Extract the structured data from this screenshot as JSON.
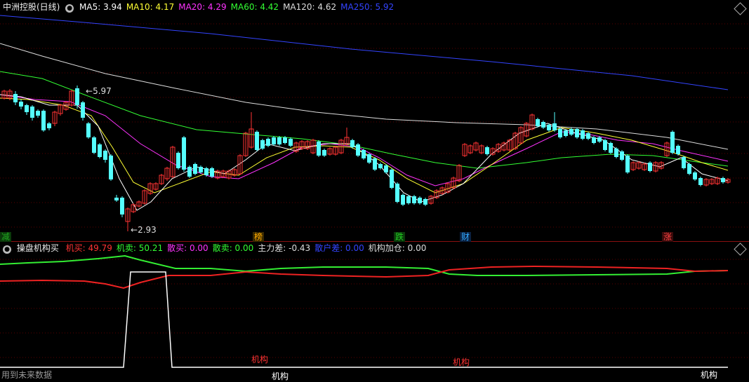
{
  "main": {
    "title": "中洲控股(日线)",
    "ma": [
      {
        "label": "MA5: 3.94",
        "color": "#ffffff"
      },
      {
        "label": "MA10: 4.17",
        "color": "#ffff33"
      },
      {
        "label": "MA20: 4.29",
        "color": "#ff33ff"
      },
      {
        "label": "MA60: 4.42",
        "color": "#33ff33"
      },
      {
        "label": "MA120: 4.62",
        "color": "#dddddd"
      },
      {
        "label": "MA250: 5.92",
        "color": "#3344ff"
      }
    ],
    "high_label": "5.97",
    "low_label": "2.93",
    "tags": [
      {
        "text": "减",
        "color": "#22aa22",
        "bg": "#0a3a0a"
      },
      {
        "text": "榜",
        "color": "#ffaa00",
        "bg": "#3a2a00"
      },
      {
        "text": "跌",
        "color": "#22cc22",
        "bg": "#0a3a0a"
      },
      {
        "text": "财",
        "color": "#33aaff",
        "bg": "#0a2040"
      },
      {
        "text": "涨",
        "color": "#ff4444",
        "bg": "#3a0a0a"
      }
    ]
  },
  "sub": {
    "title": "操盘机构买",
    "metrics": [
      {
        "label": "机买: 49.79",
        "color": "#ff3333"
      },
      {
        "label": "机卖: 50.21",
        "color": "#33ff33"
      },
      {
        "label": "散买: 0.00",
        "color": "#ff33ff"
      },
      {
        "label": "散卖: 0.00",
        "color": "#33ff33"
      },
      {
        "label": "主力差: -0.43",
        "color": "#dddddd"
      },
      {
        "label": "散户差: 0.00",
        "color": "#3344ff"
      },
      {
        "label": "机构加仓: 0.00",
        "color": "#dddddd"
      }
    ],
    "annotations": [
      {
        "text": "机构",
        "color": "#ff3333"
      },
      {
        "text": "机构",
        "color": "#ff3333"
      },
      {
        "text": "机构",
        "color": "#ffffff"
      },
      {
        "text": "机构",
        "color": "#ffffff"
      }
    ],
    "footer": "用到未来数据"
  }
}
